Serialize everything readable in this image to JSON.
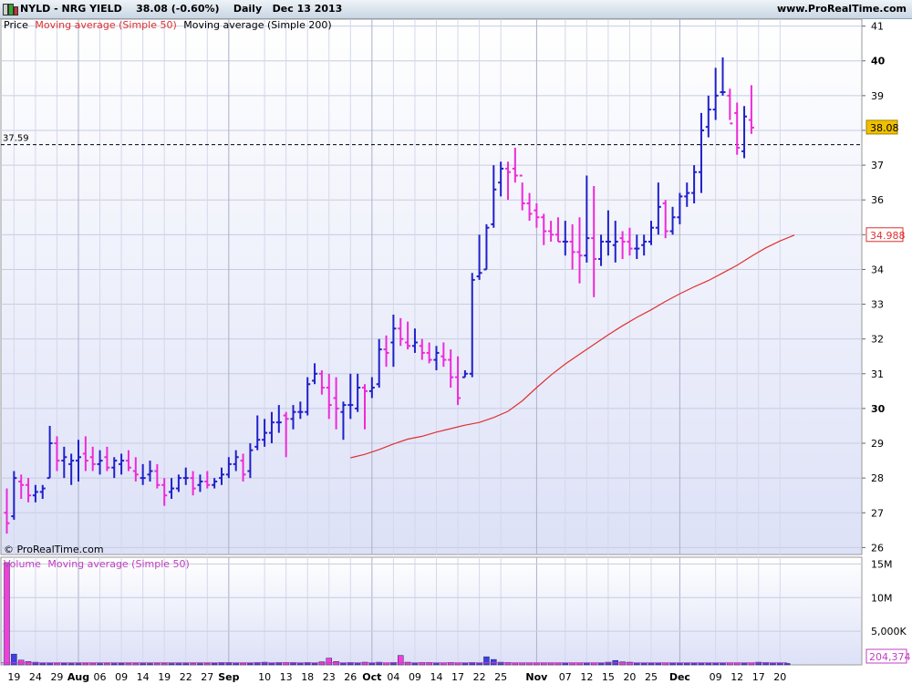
{
  "header": {
    "title": "NYLD - NRG YIELD",
    "last": "38.08 (-0.60%)",
    "period": "Daily",
    "date": "Dec 13 2013",
    "website": "www.ProRealTime.com"
  },
  "legend": {
    "price": "Price",
    "ma50": "Moving average (Simple 50)",
    "ma200": "Moving average (Simple 200)",
    "volume": "Volume",
    "vol_ma50": "Moving average (Simple 50)"
  },
  "copyright": "© ProRealTime.com",
  "colors": {
    "up": "#2020c8",
    "down": "#ee2ad8",
    "ma50": "#e03030",
    "last_badge": "#f0c000"
  },
  "chart_data": [
    {
      "type": "bar",
      "name": "price",
      "ylim": [
        25.8,
        41.2
      ],
      "y_ticks": [
        "26",
        "27",
        "28",
        "29",
        "30",
        "31",
        "32",
        "33",
        "34",
        "35",
        "36",
        "37",
        "38",
        "39",
        "40",
        "41"
      ],
      "x_labels": [
        {
          "label": "19",
          "i": 1
        },
        {
          "label": "24",
          "i": 4
        },
        {
          "label": "29",
          "i": 7
        },
        {
          "label": "Aug",
          "i": 10,
          "major": true
        },
        {
          "label": "06",
          "i": 13
        },
        {
          "label": "09",
          "i": 16
        },
        {
          "label": "14",
          "i": 19
        },
        {
          "label": "19",
          "i": 22
        },
        {
          "label": "22",
          "i": 25
        },
        {
          "label": "27",
          "i": 28
        },
        {
          "label": "Sep",
          "i": 31,
          "major": true
        },
        {
          "label": "10",
          "i": 36
        },
        {
          "label": "13",
          "i": 39
        },
        {
          "label": "18",
          "i": 42
        },
        {
          "label": "23",
          "i": 45
        },
        {
          "label": "26",
          "i": 48
        },
        {
          "label": "Oct",
          "i": 51,
          "major": true
        },
        {
          "label": "04",
          "i": 54
        },
        {
          "label": "09",
          "i": 57
        },
        {
          "label": "14",
          "i": 60
        },
        {
          "label": "17",
          "i": 63
        },
        {
          "label": "22",
          "i": 66
        },
        {
          "label": "25",
          "i": 69
        },
        {
          "label": "Nov",
          "i": 74,
          "major": true
        },
        {
          "label": "07",
          "i": 78
        },
        {
          "label": "12",
          "i": 81
        },
        {
          "label": "15",
          "i": 84
        },
        {
          "label": "20",
          "i": 87
        },
        {
          "label": "25",
          "i": 90
        },
        {
          "label": "Dec",
          "i": 94,
          "major": true
        },
        {
          "label": "09",
          "i": 99
        },
        {
          "label": "12",
          "i": 102
        },
        {
          "label": "17",
          "i": 105
        },
        {
          "label": "20",
          "i": 108
        }
      ],
      "dashed_level": 37.59,
      "dashed_level_label": "37.59",
      "last_value": 38.08,
      "last_value_label": "38.08",
      "ma50_last_label": "34.988",
      "bars": [
        {
          "o": 27.0,
          "h": 27.7,
          "l": 26.4,
          "c": 26.7
        },
        {
          "o": 26.9,
          "h": 28.2,
          "l": 26.8,
          "c": 28.0
        },
        {
          "o": 27.9,
          "h": 28.1,
          "l": 27.4,
          "c": 27.8
        },
        {
          "o": 27.8,
          "h": 28.0,
          "l": 27.3,
          "c": 27.5
        },
        {
          "o": 27.5,
          "h": 27.8,
          "l": 27.3,
          "c": 27.6
        },
        {
          "o": 27.6,
          "h": 27.8,
          "l": 27.4,
          "c": 27.7
        },
        {
          "o": 28.0,
          "h": 29.5,
          "l": 28.0,
          "c": 29.0
        },
        {
          "o": 29.0,
          "h": 29.2,
          "l": 28.2,
          "c": 28.5
        },
        {
          "o": 28.5,
          "h": 28.9,
          "l": 28.0,
          "c": 28.6
        },
        {
          "o": 28.4,
          "h": 28.7,
          "l": 27.8,
          "c": 28.5
        },
        {
          "o": 28.5,
          "h": 29.1,
          "l": 27.9,
          "c": 28.6
        },
        {
          "o": 28.7,
          "h": 29.2,
          "l": 28.2,
          "c": 28.5
        },
        {
          "o": 28.6,
          "h": 28.9,
          "l": 28.2,
          "c": 28.4
        },
        {
          "o": 28.4,
          "h": 28.8,
          "l": 28.1,
          "c": 28.5
        },
        {
          "o": 28.6,
          "h": 28.9,
          "l": 28.2,
          "c": 28.3
        },
        {
          "o": 28.3,
          "h": 28.6,
          "l": 28.0,
          "c": 28.5
        },
        {
          "o": 28.4,
          "h": 28.7,
          "l": 28.1,
          "c": 28.5
        },
        {
          "o": 28.5,
          "h": 28.8,
          "l": 28.2,
          "c": 28.3
        },
        {
          "o": 28.2,
          "h": 28.6,
          "l": 27.9,
          "c": 28.1
        },
        {
          "o": 28.0,
          "h": 28.4,
          "l": 27.8,
          "c": 28.0
        },
        {
          "o": 28.1,
          "h": 28.5,
          "l": 27.9,
          "c": 28.2
        },
        {
          "o": 28.2,
          "h": 28.4,
          "l": 27.7,
          "c": 27.8
        },
        {
          "o": 27.8,
          "h": 28.0,
          "l": 27.2,
          "c": 27.5
        },
        {
          "o": 27.6,
          "h": 28.0,
          "l": 27.4,
          "c": 27.7
        },
        {
          "o": 27.7,
          "h": 28.1,
          "l": 27.6,
          "c": 28.0
        },
        {
          "o": 28.0,
          "h": 28.3,
          "l": 27.8,
          "c": 28.0
        },
        {
          "o": 28.0,
          "h": 28.2,
          "l": 27.5,
          "c": 27.7
        },
        {
          "o": 27.8,
          "h": 28.1,
          "l": 27.6,
          "c": 27.9
        },
        {
          "o": 27.9,
          "h": 28.2,
          "l": 27.7,
          "c": 27.8
        },
        {
          "o": 27.8,
          "h": 28.0,
          "l": 27.7,
          "c": 27.9
        },
        {
          "o": 28.0,
          "h": 28.3,
          "l": 27.8,
          "c": 28.1
        },
        {
          "o": 28.1,
          "h": 28.6,
          "l": 28.0,
          "c": 28.4
        },
        {
          "o": 28.4,
          "h": 28.8,
          "l": 28.2,
          "c": 28.6
        },
        {
          "o": 28.5,
          "h": 28.7,
          "l": 27.9,
          "c": 28.1
        },
        {
          "o": 28.2,
          "h": 29.0,
          "l": 28.0,
          "c": 28.8
        },
        {
          "o": 28.9,
          "h": 29.8,
          "l": 28.8,
          "c": 29.1
        },
        {
          "o": 29.1,
          "h": 29.7,
          "l": 28.9,
          "c": 29.3
        },
        {
          "o": 29.3,
          "h": 29.9,
          "l": 29.0,
          "c": 29.6
        },
        {
          "o": 29.6,
          "h": 30.1,
          "l": 29.3,
          "c": 29.6
        },
        {
          "o": 29.8,
          "h": 29.9,
          "l": 28.6,
          "c": 29.7
        },
        {
          "o": 29.7,
          "h": 30.1,
          "l": 29.4,
          "c": 29.9
        },
        {
          "o": 29.9,
          "h": 30.2,
          "l": 29.7,
          "c": 29.9
        },
        {
          "o": 29.9,
          "h": 30.9,
          "l": 29.8,
          "c": 30.7
        },
        {
          "o": 30.8,
          "h": 31.3,
          "l": 30.7,
          "c": 31.0
        },
        {
          "o": 31.0,
          "h": 31.1,
          "l": 30.4,
          "c": 30.6
        },
        {
          "o": 30.6,
          "h": 31.0,
          "l": 29.7,
          "c": 30.1
        },
        {
          "o": 30.3,
          "h": 30.9,
          "l": 29.4,
          "c": 30.0
        },
        {
          "o": 29.9,
          "h": 30.2,
          "l": 29.1,
          "c": 30.1
        },
        {
          "o": 30.1,
          "h": 31.0,
          "l": 29.7,
          "c": 30.1
        },
        {
          "o": 30.0,
          "h": 31.0,
          "l": 29.9,
          "c": 30.6
        },
        {
          "o": 30.6,
          "h": 30.7,
          "l": 29.4,
          "c": 30.5
        },
        {
          "o": 30.5,
          "h": 30.9,
          "l": 30.3,
          "c": 30.6
        },
        {
          "o": 30.7,
          "h": 32.0,
          "l": 30.6,
          "c": 31.7
        },
        {
          "o": 31.7,
          "h": 32.1,
          "l": 31.2,
          "c": 31.6
        },
        {
          "o": 31.9,
          "h": 32.7,
          "l": 31.2,
          "c": 32.3
        },
        {
          "o": 32.3,
          "h": 32.6,
          "l": 31.8,
          "c": 32.0
        },
        {
          "o": 31.9,
          "h": 32.5,
          "l": 31.7,
          "c": 31.8
        },
        {
          "o": 31.8,
          "h": 32.3,
          "l": 31.6,
          "c": 31.9
        },
        {
          "o": 31.8,
          "h": 32.0,
          "l": 31.4,
          "c": 31.6
        },
        {
          "o": 31.6,
          "h": 31.9,
          "l": 31.3,
          "c": 31.4
        },
        {
          "o": 31.4,
          "h": 31.8,
          "l": 31.1,
          "c": 31.6
        },
        {
          "o": 31.5,
          "h": 31.9,
          "l": 31.2,
          "c": 31.4
        },
        {
          "o": 31.4,
          "h": 31.7,
          "l": 30.6,
          "c": 30.9
        },
        {
          "o": 30.9,
          "h": 31.5,
          "l": 30.1,
          "c": 30.3
        },
        {
          "o": 30.9,
          "h": 31.1,
          "l": 30.9,
          "c": 31.0
        },
        {
          "o": 31.0,
          "h": 33.9,
          "l": 30.9,
          "c": 33.7
        },
        {
          "o": 33.8,
          "h": 35.0,
          "l": 33.7,
          "c": 33.9
        },
        {
          "o": 34.0,
          "h": 35.3,
          "l": 34.0,
          "c": 35.2
        },
        {
          "o": 35.3,
          "h": 37.0,
          "l": 35.2,
          "c": 36.3
        },
        {
          "o": 36.5,
          "h": 37.1,
          "l": 36.1,
          "c": 36.9
        },
        {
          "o": 36.9,
          "h": 37.1,
          "l": 36.0,
          "c": 36.8
        },
        {
          "o": 36.9,
          "h": 37.5,
          "l": 36.5,
          "c": 36.7
        },
        {
          "o": 36.7,
          "h": 36.5,
          "l": 35.7,
          "c": 35.9
        },
        {
          "o": 35.9,
          "h": 36.2,
          "l": 35.4,
          "c": 35.6
        },
        {
          "o": 35.7,
          "h": 35.9,
          "l": 35.2,
          "c": 35.5
        },
        {
          "o": 35.5,
          "h": 35.6,
          "l": 34.7,
          "c": 35.1
        },
        {
          "o": 35.1,
          "h": 35.4,
          "l": 34.8,
          "c": 35.0
        },
        {
          "o": 35.0,
          "h": 35.5,
          "l": 34.8,
          "c": 34.8
        },
        {
          "o": 34.8,
          "h": 35.4,
          "l": 34.4,
          "c": 34.8
        },
        {
          "o": 34.8,
          "h": 35.3,
          "l": 34.0,
          "c": 34.5
        },
        {
          "o": 34.5,
          "h": 35.5,
          "l": 33.6,
          "c": 34.4
        },
        {
          "o": 34.4,
          "h": 36.7,
          "l": 34.2,
          "c": 34.9
        },
        {
          "o": 34.9,
          "h": 36.4,
          "l": 33.2,
          "c": 34.3
        },
        {
          "o": 34.3,
          "h": 35.0,
          "l": 34.1,
          "c": 34.8
        },
        {
          "o": 34.8,
          "h": 35.7,
          "l": 34.4,
          "c": 34.8
        },
        {
          "o": 34.7,
          "h": 35.4,
          "l": 34.2,
          "c": 34.8
        },
        {
          "o": 34.9,
          "h": 35.1,
          "l": 34.3,
          "c": 34.8
        },
        {
          "o": 34.8,
          "h": 35.2,
          "l": 34.4,
          "c": 34.6
        },
        {
          "o": 34.6,
          "h": 35.0,
          "l": 34.3,
          "c": 34.6
        },
        {
          "o": 34.7,
          "h": 35.0,
          "l": 34.4,
          "c": 34.8
        },
        {
          "o": 34.8,
          "h": 35.4,
          "l": 34.7,
          "c": 35.2
        },
        {
          "o": 35.2,
          "h": 36.5,
          "l": 35.0,
          "c": 35.8
        },
        {
          "o": 35.9,
          "h": 36.0,
          "l": 34.9,
          "c": 35.1
        },
        {
          "o": 35.1,
          "h": 35.8,
          "l": 35.0,
          "c": 35.5
        },
        {
          "o": 35.5,
          "h": 36.2,
          "l": 35.3,
          "c": 36.1
        },
        {
          "o": 36.1,
          "h": 36.5,
          "l": 35.8,
          "c": 36.2
        },
        {
          "o": 36.2,
          "h": 37.0,
          "l": 35.9,
          "c": 36.8
        },
        {
          "o": 36.8,
          "h": 38.5,
          "l": 36.2,
          "c": 38.0
        },
        {
          "o": 38.1,
          "h": 39.0,
          "l": 37.8,
          "c": 38.6
        },
        {
          "o": 38.6,
          "h": 39.8,
          "l": 38.3,
          "c": 39.0
        },
        {
          "o": 39.1,
          "h": 40.1,
          "l": 39.0,
          "c": 39.1
        },
        {
          "o": 39.0,
          "h": 39.2,
          "l": 38.3,
          "c": 38.2
        },
        {
          "o": 38.5,
          "h": 38.8,
          "l": 37.3,
          "c": 37.5
        },
        {
          "o": 37.4,
          "h": 38.7,
          "l": 37.2,
          "c": 38.4
        },
        {
          "o": 38.3,
          "h": 39.3,
          "l": 37.9,
          "c": 38.08
        }
      ],
      "ma50": [
        {
          "i": 48,
          "v": 28.58
        },
        {
          "i": 50,
          "v": 28.68
        },
        {
          "i": 52,
          "v": 28.82
        },
        {
          "i": 54,
          "v": 28.98
        },
        {
          "i": 56,
          "v": 29.12
        },
        {
          "i": 58,
          "v": 29.2
        },
        {
          "i": 60,
          "v": 29.32
        },
        {
          "i": 62,
          "v": 29.42
        },
        {
          "i": 64,
          "v": 29.52
        },
        {
          "i": 66,
          "v": 29.6
        },
        {
          "i": 68,
          "v": 29.74
        },
        {
          "i": 70,
          "v": 29.92
        },
        {
          "i": 72,
          "v": 30.22
        },
        {
          "i": 74,
          "v": 30.6
        },
        {
          "i": 76,
          "v": 30.96
        },
        {
          "i": 78,
          "v": 31.28
        },
        {
          "i": 80,
          "v": 31.56
        },
        {
          "i": 82,
          "v": 31.84
        },
        {
          "i": 84,
          "v": 32.12
        },
        {
          "i": 86,
          "v": 32.38
        },
        {
          "i": 88,
          "v": 32.62
        },
        {
          "i": 90,
          "v": 32.84
        },
        {
          "i": 92,
          "v": 33.08
        },
        {
          "i": 94,
          "v": 33.3
        },
        {
          "i": 96,
          "v": 33.5
        },
        {
          "i": 98,
          "v": 33.68
        },
        {
          "i": 100,
          "v": 33.9
        },
        {
          "i": 102,
          "v": 34.12
        },
        {
          "i": 104,
          "v": 34.38
        },
        {
          "i": 106,
          "v": 34.62
        },
        {
          "i": 108,
          "v": 34.82
        },
        {
          "i": 110,
          "v": 34.988
        }
      ]
    },
    {
      "type": "bar",
      "name": "volume",
      "ylim": [
        0,
        16000000
      ],
      "y_ticks": [
        "5,000K",
        "10M",
        "15M"
      ],
      "last_value_label": "204,374",
      "volumes": [
        15200000,
        1600000,
        700000,
        500000,
        400000,
        300000,
        300000,
        250000,
        250000,
        200000,
        200000,
        250000,
        250000,
        200000,
        200000,
        200000,
        250000,
        200000,
        200000,
        200000,
        200000,
        200000,
        200000,
        200000,
        200000,
        200000,
        200000,
        200000,
        200000,
        250000,
        350000,
        350000,
        300000,
        250000,
        250000,
        350000,
        400000,
        300000,
        350000,
        350000,
        350000,
        300000,
        350000,
        300000,
        450000,
        1000000,
        500000,
        300000,
        350000,
        300000,
        400000,
        300000,
        400000,
        300000,
        350000,
        1400000,
        400000,
        300000,
        350000,
        350000,
        300000,
        300000,
        350000,
        300000,
        300000,
        350000,
        300000,
        1200000,
        800000,
        400000,
        350000,
        300000,
        300000,
        300000,
        300000,
        300000,
        300000,
        300000,
        300000,
        300000,
        300000,
        300000,
        300000,
        300000,
        400000,
        650000,
        450000,
        400000,
        300000,
        300000,
        300000,
        300000,
        300000,
        300000,
        300000,
        300000,
        300000,
        300000,
        300000,
        300000,
        300000,
        300000,
        300000,
        300000,
        300000,
        400000,
        350000,
        300000,
        300000,
        204374
      ],
      "ma50_at_end": 300000
    }
  ]
}
